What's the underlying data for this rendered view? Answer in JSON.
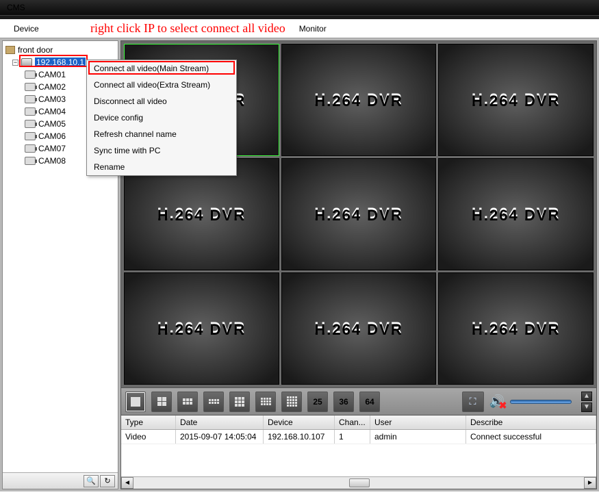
{
  "window": {
    "title": "CMS"
  },
  "topnav": {
    "device": "Device",
    "monitor": "Monitor",
    "hint": "right click IP to select connect all video"
  },
  "tree": {
    "root": "front door",
    "device_ip": "192.168.10.1",
    "cams": [
      "CAM01",
      "CAM02",
      "CAM03",
      "CAM04",
      "CAM05",
      "CAM06",
      "CAM07",
      "CAM08"
    ]
  },
  "context_menu": {
    "items": [
      "Connect all video(Main Stream)",
      "Connect all video(Extra Stream)",
      "Disconnect all video",
      "Device config",
      "Refresh channel name",
      "Sync time with PC",
      "Rename"
    ]
  },
  "tile_text": "H.264 DVR",
  "grid_nums": {
    "g25": "25",
    "g36": "36",
    "g64": "64"
  },
  "log": {
    "headers": {
      "type": "Type",
      "date": "Date",
      "device": "Device",
      "channel": "Chan...",
      "user": "User",
      "describe": "Describe"
    },
    "rows": [
      {
        "type": "Video",
        "date": "2015-09-07 14:05:04",
        "device": "192.168.10.107",
        "channel": "1",
        "user": "admin",
        "describe": "Connect successful"
      }
    ]
  }
}
